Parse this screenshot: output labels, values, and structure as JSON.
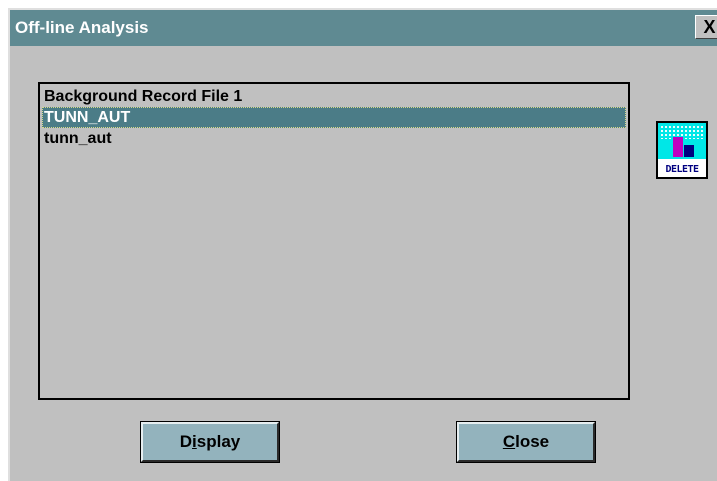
{
  "window": {
    "title": "Off-line Analysis",
    "close_glyph": "X"
  },
  "list": {
    "items": [
      {
        "label": "Background Record File 1",
        "selected": false
      },
      {
        "label": "TUNN_AUT",
        "selected": true
      },
      {
        "label": "tunn_aut",
        "selected": false
      }
    ]
  },
  "delete_button": {
    "icon": "delete-trash-icon",
    "label": "DELETE"
  },
  "buttons": {
    "display": {
      "pre": "D",
      "accel": "i",
      "post": "splay"
    },
    "close": {
      "pre": "",
      "accel": "C",
      "post": "lose"
    }
  },
  "colors": {
    "titlebar": "#5f8a92",
    "selection": "#4b7c87",
    "button_face": "#93b3bd",
    "dialog_bg": "#c0c0c0"
  }
}
